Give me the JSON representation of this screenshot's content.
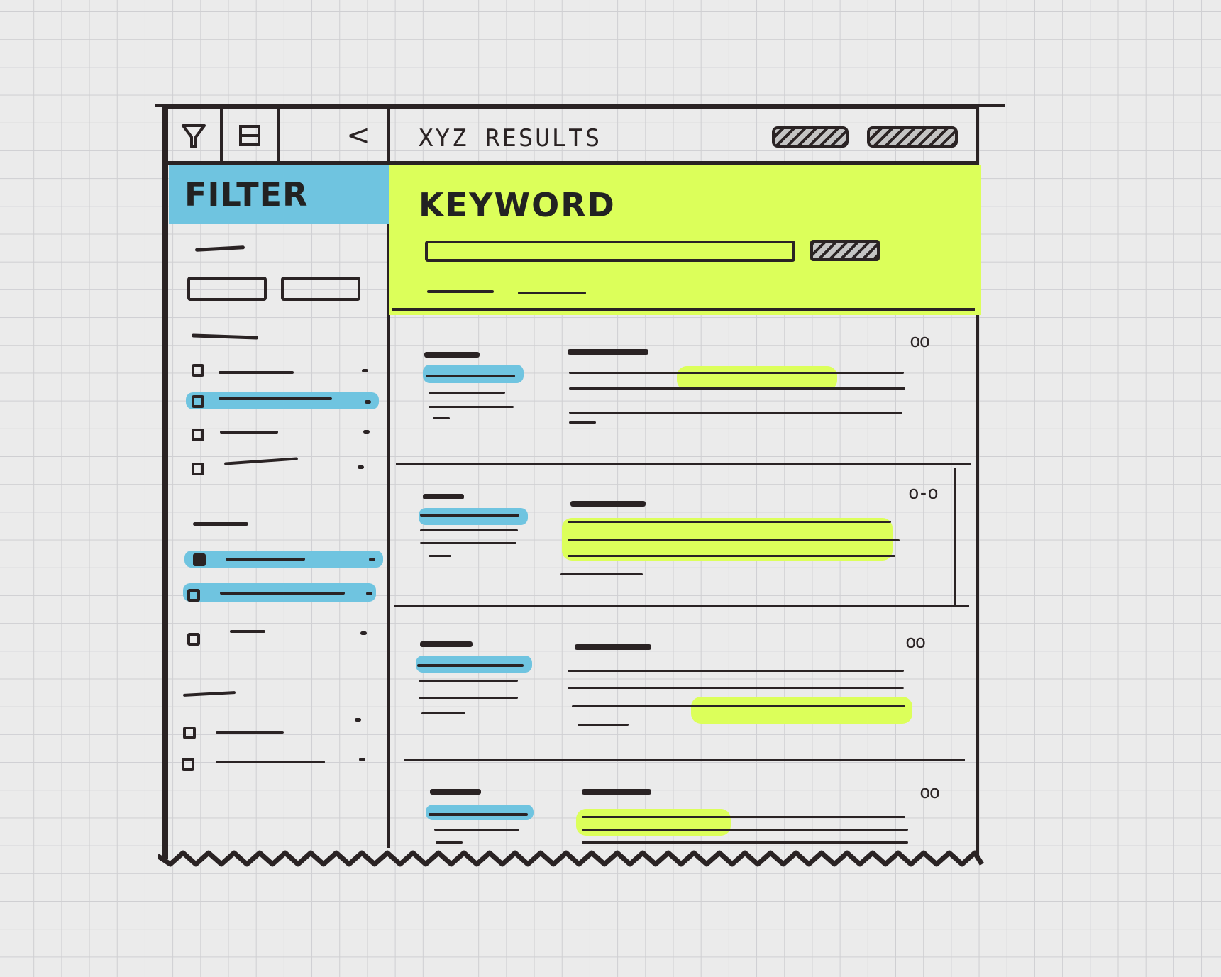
{
  "toolbar": {
    "filter_icon": "funnel-icon",
    "grid_icon": "grid-icon",
    "collapse_icon": "chevron-left-icon",
    "collapse_glyph": "<",
    "title": "XYZ RESULTS"
  },
  "sidebar": {
    "header": "FILTER",
    "groups": [
      {
        "items": [
          {
            "checked": false,
            "highlighted": false
          },
          {
            "checked": false,
            "highlighted": true
          },
          {
            "checked": false,
            "highlighted": false
          },
          {
            "checked": false,
            "highlighted": false
          }
        ]
      },
      {
        "items": [
          {
            "checked": true,
            "highlighted": true
          },
          {
            "checked": false,
            "highlighted": true
          },
          {
            "checked": false,
            "highlighted": false
          }
        ]
      },
      {
        "items": [
          {
            "checked": false,
            "highlighted": false
          },
          {
            "checked": false,
            "highlighted": false
          }
        ]
      }
    ]
  },
  "search": {
    "label": "KEYWORD"
  },
  "results": [
    {
      "rating": "oo"
    },
    {
      "rating": "o-o"
    },
    {
      "rating": "oo"
    },
    {
      "rating": "oo"
    }
  ],
  "colors": {
    "ink": "#2a2324",
    "highlight_blue": "#6fc4e0",
    "highlight_yellow": "#dcff5a",
    "paper": "#ebebeb"
  }
}
